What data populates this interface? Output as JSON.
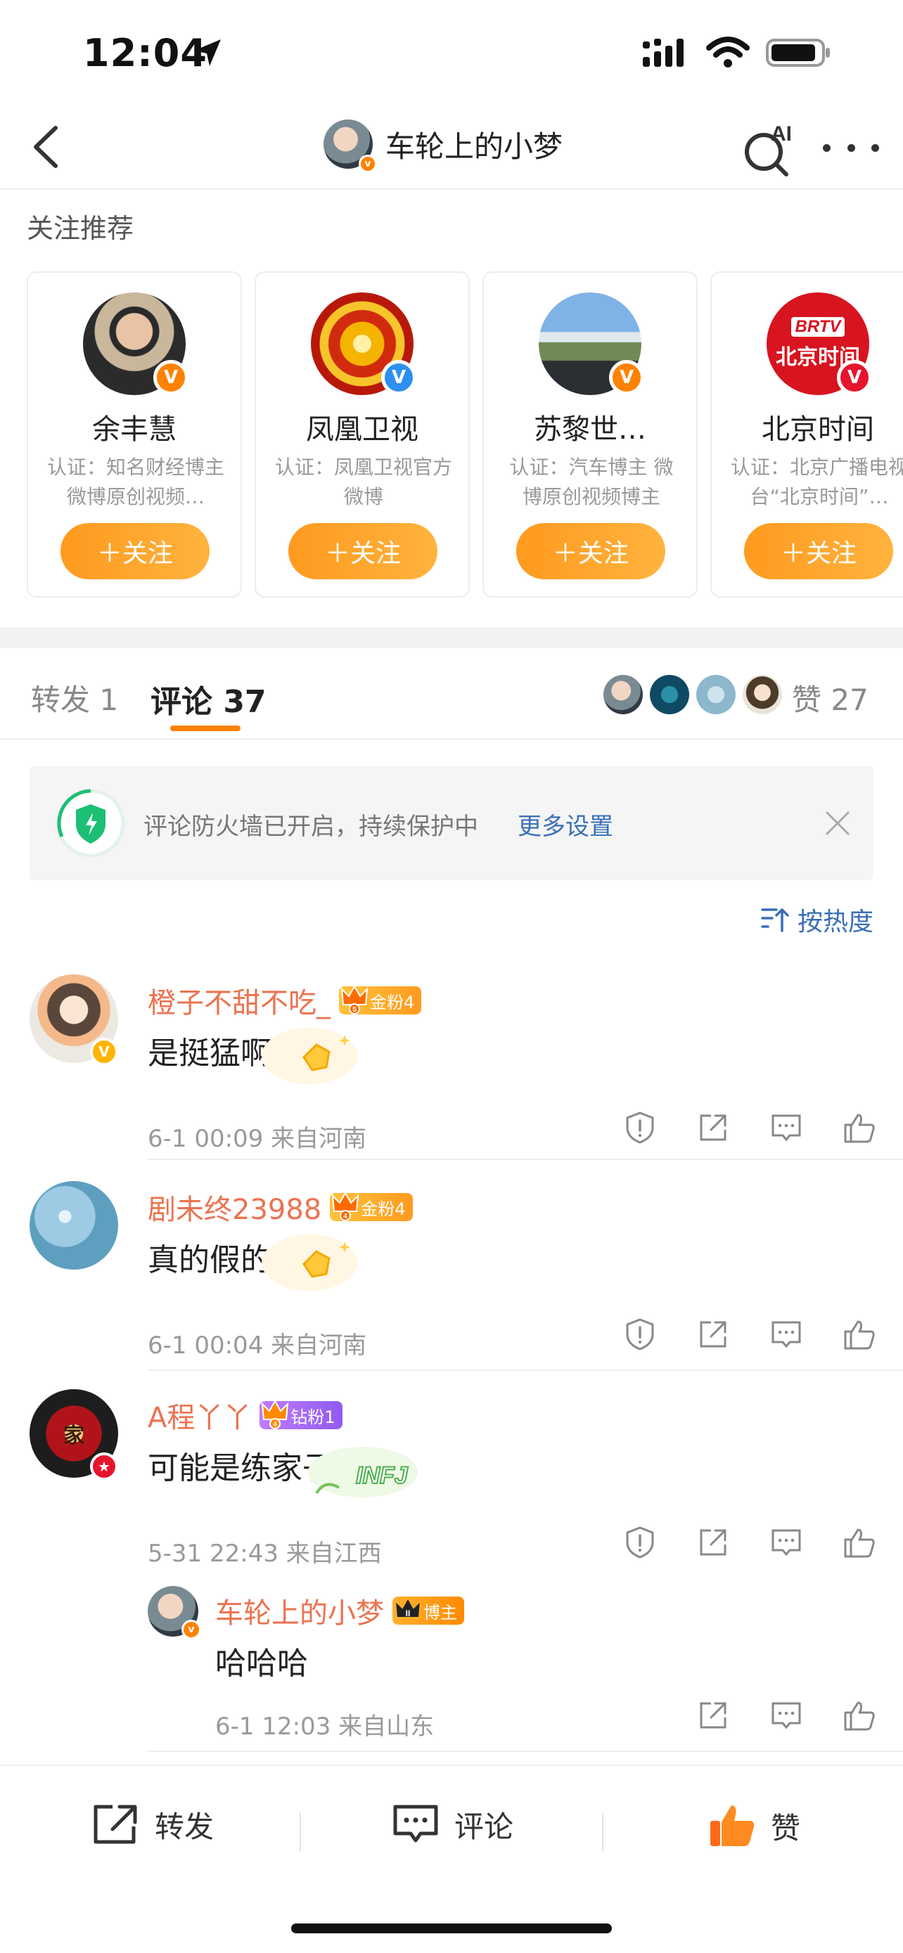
{
  "status_bar": {
    "time": "12:04"
  },
  "header": {
    "title": "车轮上的小梦",
    "ai_label": "AI"
  },
  "recommend": {
    "title": "关注推荐",
    "follow_label": "＋关注",
    "cards": [
      {
        "name": "余丰慧",
        "desc": "认证：知名财经博主 微博原创视频…",
        "badge": "orange"
      },
      {
        "name": "凤凰卫视",
        "desc": "认证：凤凰卫视官方微博",
        "badge": "blue"
      },
      {
        "name": "苏黎世…",
        "desc": "认证：汽车博主 微博原创视频博主",
        "badge": "orange"
      },
      {
        "name": "北京时间",
        "desc": "认证：北京广播电视台“北京时间”…",
        "badge": "red",
        "logo_text": "北京时间",
        "logo_brand": "BRTV"
      }
    ]
  },
  "tabs": {
    "repost": "转发 1",
    "comment": "评论 37",
    "like": "赞 27"
  },
  "firewall": {
    "text": "评论防火墙已开启，持续保护中",
    "link": "更多设置"
  },
  "sort": {
    "label": "按热度"
  },
  "comments": [
    {
      "name": "橙子不甜不吃_",
      "fan_badge": "金粉4",
      "fan_level": "5",
      "text": "是挺猛啊",
      "meta": "6-1 00:09  来自河南"
    },
    {
      "name": "剧未终23988",
      "fan_badge": "金粉4",
      "fan_level": "4",
      "text": "真的假的",
      "meta": "6-1 00:04  来自河南"
    },
    {
      "name": "A程丫丫",
      "fan_badge": "钻粉1",
      "fan_level": "4",
      "text": "可能是练家子",
      "meta": "5-31 22:43  来自江西",
      "deco_text": "INFJ",
      "avatar_char": "家"
    }
  ],
  "reply": {
    "name": "车轮上的小梦",
    "badge": "博主",
    "badge_level": "II",
    "text": "哈哈哈",
    "meta": "6-1 12:03  来自山东"
  },
  "bottom_bar": {
    "repost": "转发",
    "comment": "评论",
    "like": "赞"
  },
  "colors": {
    "accent": "#ff8200",
    "link": "#3a6fb6",
    "username": "#eb7350"
  }
}
